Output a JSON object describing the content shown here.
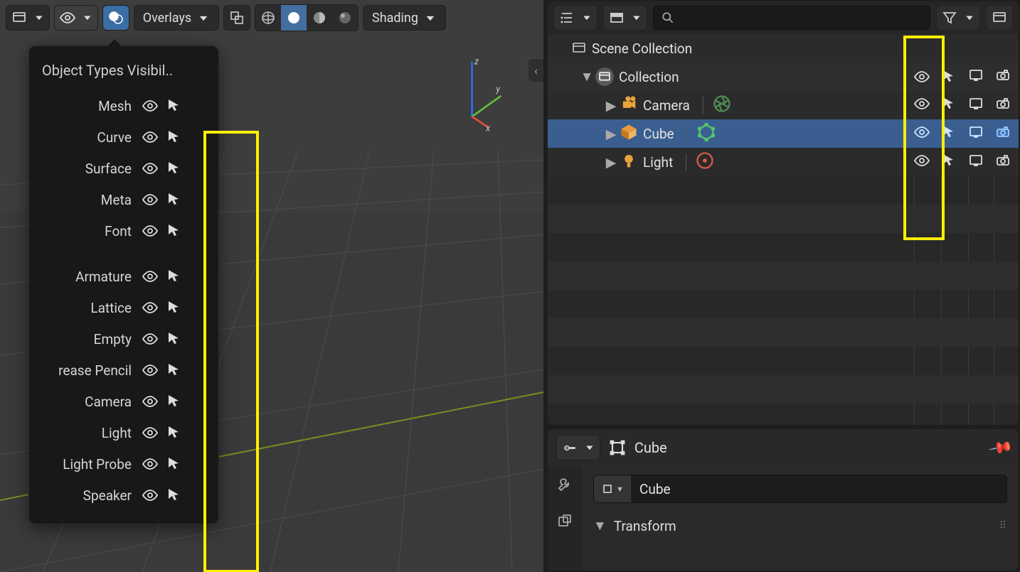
{
  "viewport_header": {
    "overlays_label": "Overlays",
    "shading_label": "Shading"
  },
  "gizmo": {
    "x": "x",
    "y": "y",
    "z": "z"
  },
  "popover": {
    "title": "Object Types Visibil..",
    "group1": [
      "Mesh",
      "Curve",
      "Surface",
      "Meta",
      "Font"
    ],
    "group2": [
      "Armature",
      "Lattice",
      "Empty",
      "rease Pencil",
      "Camera",
      "Light",
      "Light Probe",
      "Speaker"
    ]
  },
  "outliner": {
    "scene_collection": "Scene Collection",
    "collection": "Collection",
    "items": [
      {
        "name": "Camera",
        "icon": "camera",
        "data_icon": "aperture"
      },
      {
        "name": "Cube",
        "icon": "mesh",
        "data_icon": "mesh-data",
        "selected": true
      },
      {
        "name": "Light",
        "icon": "light",
        "data_icon": "light-data"
      }
    ]
  },
  "properties": {
    "context_label": "Cube",
    "name_value": "Cube",
    "transform_label": "Transform"
  }
}
